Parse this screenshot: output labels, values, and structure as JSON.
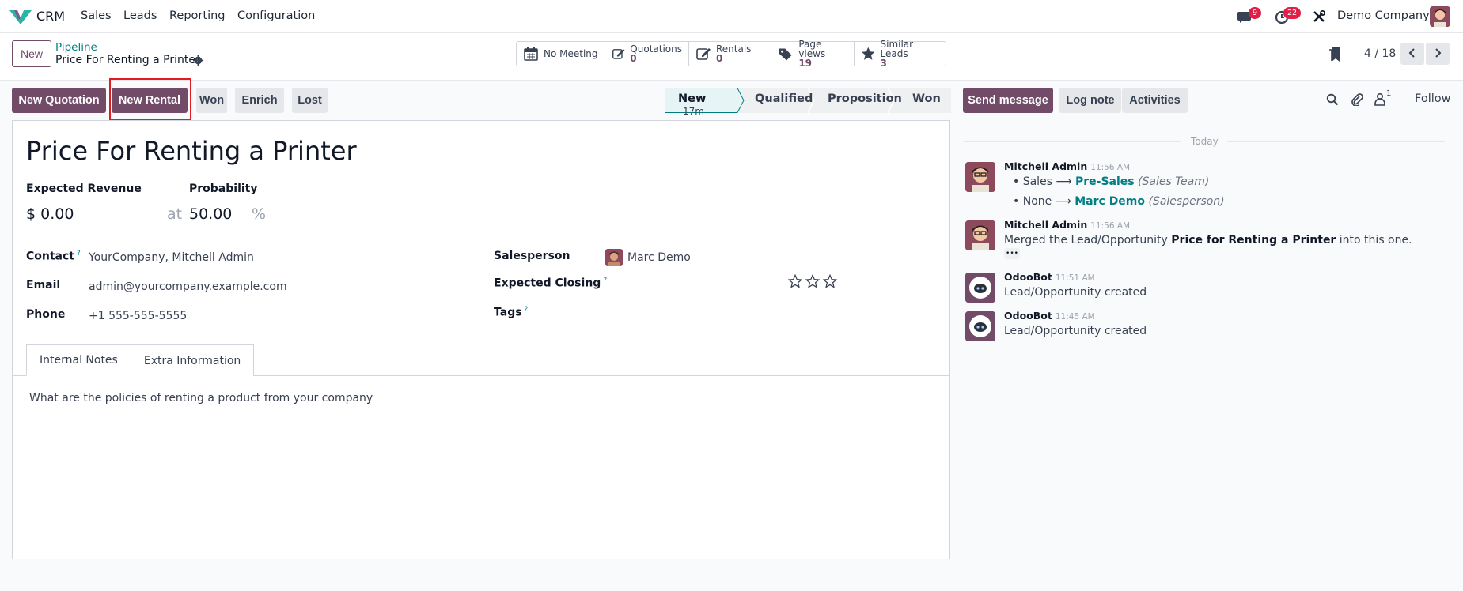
{
  "navbar": {
    "app_name": "CRM",
    "menu": [
      "Sales",
      "Leads",
      "Reporting",
      "Configuration"
    ],
    "messages_count": "9",
    "activities_count": "22",
    "company": "Demo Company"
  },
  "control": {
    "new_label": "New",
    "breadcrumb_parent": "Pipeline",
    "breadcrumb_current": "Price For Renting a Printer",
    "smart_buttons": [
      {
        "label": "No Meeting",
        "count": "",
        "icon": "calendar-icon"
      },
      {
        "label": "Quotations",
        "count": "0",
        "icon": "pencil-square-icon"
      },
      {
        "label": "Rentals",
        "count": "0",
        "icon": "pencil-square-icon"
      },
      {
        "label": "Page views",
        "count": "19",
        "icon": "tags-icon"
      },
      {
        "label": "Similar Leads",
        "count": "3",
        "icon": "star-icon"
      }
    ],
    "pager": "4 / 18"
  },
  "statusbar": {
    "buttons": [
      "New Quotation",
      "New Rental",
      "Won",
      "Enrich",
      "Lost"
    ],
    "stages": [
      {
        "label": "New",
        "duration": "17m",
        "active": true
      },
      {
        "label": "Qualified"
      },
      {
        "label": "Proposition"
      },
      {
        "label": "Won"
      }
    ]
  },
  "form": {
    "title": "Price For Renting a Printer",
    "expected_revenue_label": "Expected Revenue",
    "expected_revenue": "$ 0.00",
    "at_label": "at",
    "probability_label": "Probability",
    "probability": "50.00",
    "percent": "%",
    "contact_label": "Contact",
    "contact": "YourCompany, Mitchell Admin",
    "email_label": "Email",
    "email": "admin@yourcompany.example.com",
    "phone_label": "Phone",
    "phone": "+1 555-555-5555",
    "salesperson_label": "Salesperson",
    "salesperson": "Marc Demo",
    "expected_closing_label": "Expected Closing",
    "tags_label": "Tags",
    "help_mark": "?",
    "priority_stars": 0,
    "tabs": [
      "Internal Notes",
      "Extra Information"
    ],
    "notes": "What are the policies of renting a product from your company"
  },
  "chatter": {
    "send_message": "Send message",
    "log_note": "Log note",
    "activities": "Activities",
    "followers_count": "1",
    "follow": "Follow",
    "date_divider": "Today",
    "messages": [
      {
        "author": "Mitchell Admin",
        "time": "11:56 AM",
        "tracking": [
          {
            "old": "Sales",
            "new": "Pre-Sales",
            "field": "(Sales Team)"
          },
          {
            "old": "None",
            "new": "Marc Demo",
            "field": "(Salesperson)"
          }
        ]
      },
      {
        "author": "Mitchell Admin",
        "time": "11:56 AM",
        "body_pre": "Merged the Lead/Opportunity ",
        "body_bold": "Price for Renting a Printer",
        "body_post": " into this one.",
        "more": "•••"
      },
      {
        "author": "OdooBot",
        "time": "11:51 AM",
        "body": "Lead/Opportunity created"
      },
      {
        "author": "OdooBot",
        "time": "11:45 AM",
        "body": "Lead/Opportunity created"
      }
    ]
  },
  "colors": {
    "brand": "#714b67",
    "link": "#017e84",
    "highlight": "#e01b24",
    "badge": "#e11d48"
  }
}
